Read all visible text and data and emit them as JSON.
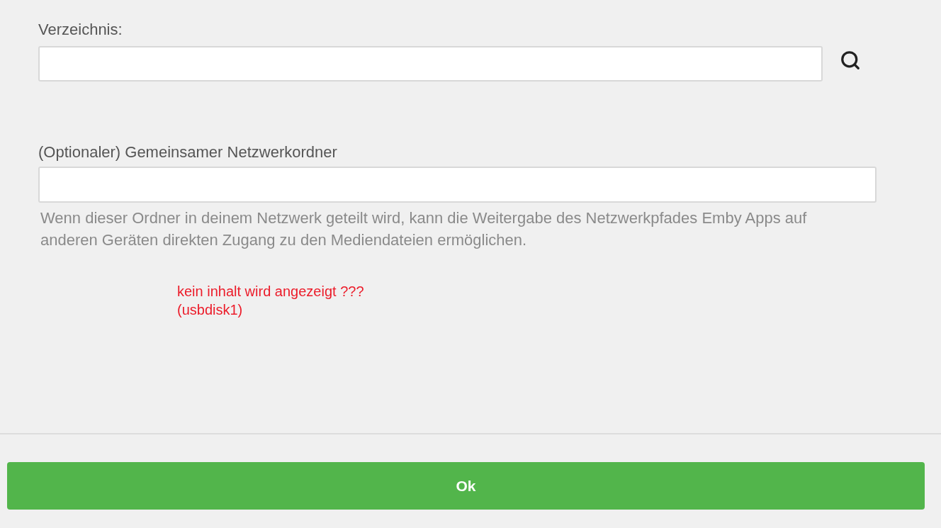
{
  "directory": {
    "label": "Verzeichnis:"
  },
  "network_share": {
    "label": "(Optionaler) Gemeinsamer Netzwerkordner",
    "help": "Wenn dieser Ordner in deinem Netzwerk geteilt wird, kann die Weitergabe des Netzwerkpfades Emby Apps auf anderen Geräten direkten Zugang zu den Mediendateien ermöglichen."
  },
  "annotation": {
    "lines": [
      "kein inhalt wird angezeigt ???",
      "(usbdisk1)"
    ]
  },
  "ok_button": {
    "label": "Ok"
  }
}
